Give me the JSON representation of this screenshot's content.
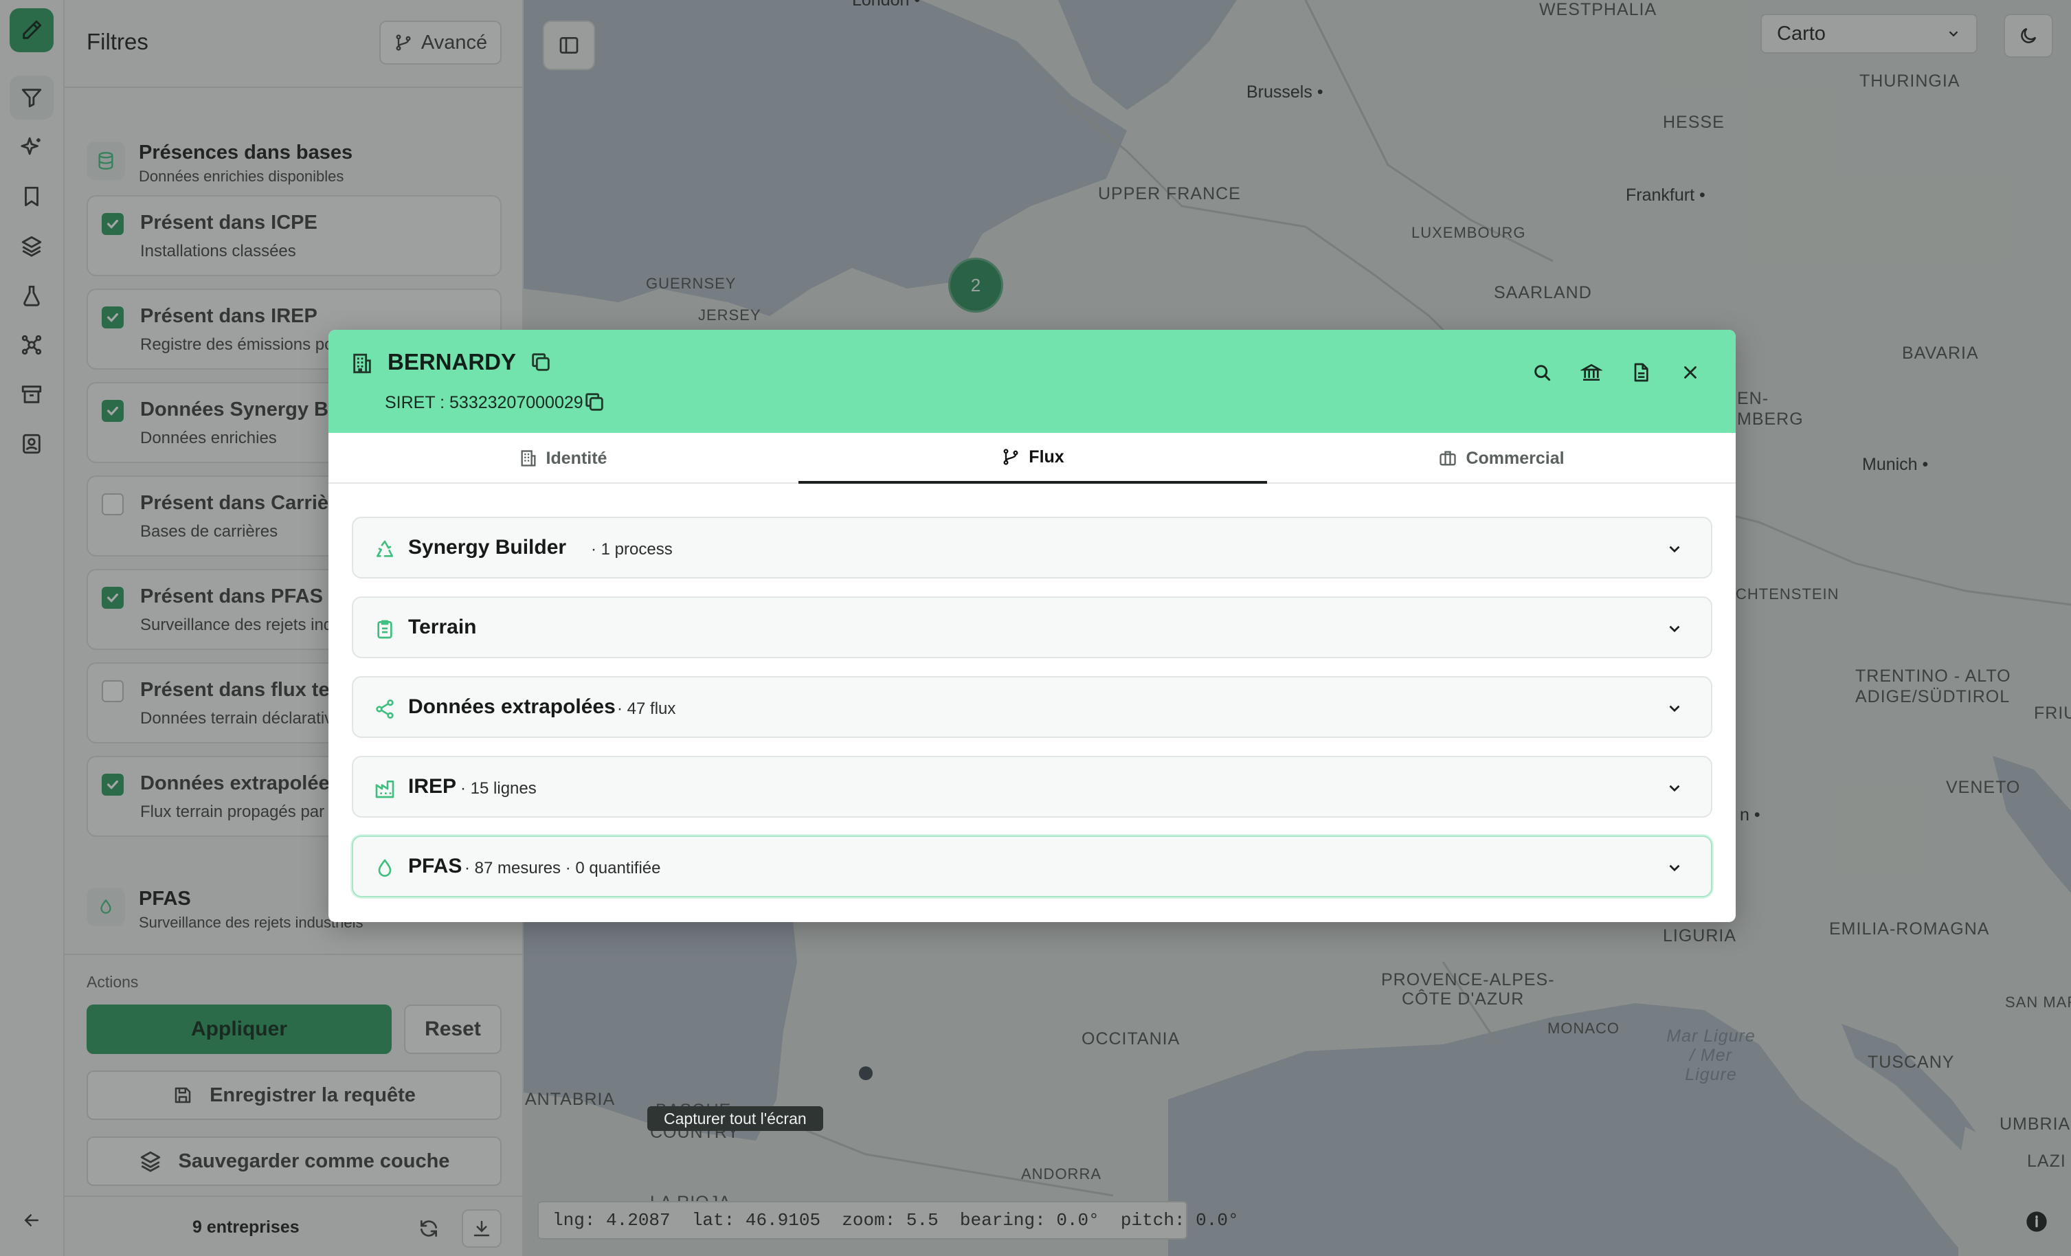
{
  "map": {
    "labels": [
      {
        "text": "WESTPHALIA",
        "kind": "region"
      },
      {
        "text": "THURINGIA",
        "kind": "region"
      },
      {
        "text": "HESSE",
        "kind": "region"
      },
      {
        "text": "UPPER FRANCE",
        "kind": "region"
      },
      {
        "text": "LUXEMBOURG",
        "kind": "region"
      },
      {
        "text": "SAARLAND",
        "kind": "region"
      },
      {
        "text": "GUERNSEY",
        "kind": "region"
      },
      {
        "text": "JERSEY",
        "kind": "region"
      },
      {
        "text": "BAVARIA",
        "kind": "region"
      },
      {
        "text": "EN-",
        "kind": "region"
      },
      {
        "text": "MBERG",
        "kind": "region"
      },
      {
        "text": "CHTENSTEIN",
        "kind": "region"
      },
      {
        "text": "TRENTINO - ALTO",
        "kind": "region"
      },
      {
        "text": "ADIGE/SÜDTIROL",
        "kind": "region"
      },
      {
        "text": "FRIUL",
        "kind": "region"
      },
      {
        "text": "VENETO",
        "kind": "region"
      },
      {
        "text": "LIGURIA",
        "kind": "region"
      },
      {
        "text": "EMILIA-ROMAGNA",
        "kind": "region"
      },
      {
        "text": "PROVENCE-ALPES-",
        "kind": "region"
      },
      {
        "text": "CÔTE D'AZUR",
        "kind": "region"
      },
      {
        "text": "MONACO",
        "kind": "region"
      },
      {
        "text": "OCCITANIA",
        "kind": "region"
      },
      {
        "text": "TUSCANY",
        "kind": "region"
      },
      {
        "text": "SAN MARI",
        "kind": "region"
      },
      {
        "text": "UMBRIA",
        "kind": "region"
      },
      {
        "text": "ANTABRIA",
        "kind": "region"
      },
      {
        "text": "BASQUE",
        "kind": "region"
      },
      {
        "text": "COUNTRY",
        "kind": "region"
      },
      {
        "text": "LA RIOJA",
        "kind": "region"
      },
      {
        "text": "ANDORRA",
        "kind": "region"
      },
      {
        "text": "LAZI",
        "kind": "region"
      },
      {
        "text": "Brussels",
        "kind": "city"
      },
      {
        "text": "Frankfurt",
        "kind": "city"
      },
      {
        "text": "Munich",
        "kind": "city"
      },
      {
        "text": "London",
        "kind": "city"
      },
      {
        "text": "n",
        "kind": "city"
      },
      {
        "text": "Mar Ligure / Mer Ligure",
        "kind": "sea"
      }
    ],
    "cluster_count": "2",
    "style_select": {
      "value": "Carto"
    },
    "coords": "lng: 4.2087  lat: 46.9105  zoom: 5.5  bearing: 0.0°  pitch: 0.0°",
    "capture_tooltip": "Capturer tout l'écran"
  },
  "filters": {
    "title": "Filtres",
    "advanced_label": "Avancé",
    "presence_section": {
      "title": "Présences dans bases",
      "subtitle": "Données enrichies disponibles"
    },
    "items": [
      {
        "title": "Présent dans ICPE",
        "subtitle": "Installations classées",
        "checked": true
      },
      {
        "title": "Présent dans IREP",
        "subtitle": "Registre des émissions po",
        "checked": true
      },
      {
        "title": "Données Synergy Bu",
        "subtitle": "Données enrichies",
        "checked": true
      },
      {
        "title": "Présent dans Carrièr",
        "subtitle": "Bases de carrières",
        "checked": false
      },
      {
        "title": "Présent dans PFAS",
        "subtitle": "Surveillance des rejets ind",
        "checked": true
      },
      {
        "title": "Présent dans flux ter",
        "subtitle": "Données terrain déclarativ",
        "checked": false
      },
      {
        "title": "Données extrapolées",
        "subtitle": "Flux terrain propagés par",
        "checked": true
      }
    ],
    "pfas_section": {
      "title": "PFAS",
      "subtitle": "Surveillance des rejets industriels"
    },
    "actions_label": "Actions",
    "apply_label": "Appliquer",
    "reset_label": "Reset",
    "save_query_label": "Enregistrer la requête",
    "save_layer_label": "Sauvegarder comme couche",
    "count_label": "9 entreprises"
  },
  "modal": {
    "company_name": "BERNARDY",
    "siret": "SIRET : 53323207000029",
    "tabs": [
      {
        "label": "Identité",
        "icon": "building-icon",
        "active": false
      },
      {
        "label": "Flux",
        "icon": "git-branch-icon",
        "active": true
      },
      {
        "label": "Commercial",
        "icon": "briefcase-icon",
        "active": false
      }
    ],
    "sections": [
      {
        "title": "Synergy Builder",
        "meta": "· 1 process",
        "icon": "recycle-icon"
      },
      {
        "title": "Terrain",
        "meta": "",
        "icon": "clipboard-icon"
      },
      {
        "title": "Données extrapolées",
        "meta": "· 47 flux",
        "icon": "share-icon"
      },
      {
        "title": "IREP",
        "meta": "· 15 lignes",
        "icon": "factory-icon"
      },
      {
        "title": "PFAS",
        "meta": "· 87 mesures · 0 quantifiée",
        "icon": "droplet-icon"
      }
    ]
  },
  "colors": {
    "accent": "#2e9a60",
    "modal_header": "#72e3ad",
    "icon_green": "#3fbf7f"
  }
}
